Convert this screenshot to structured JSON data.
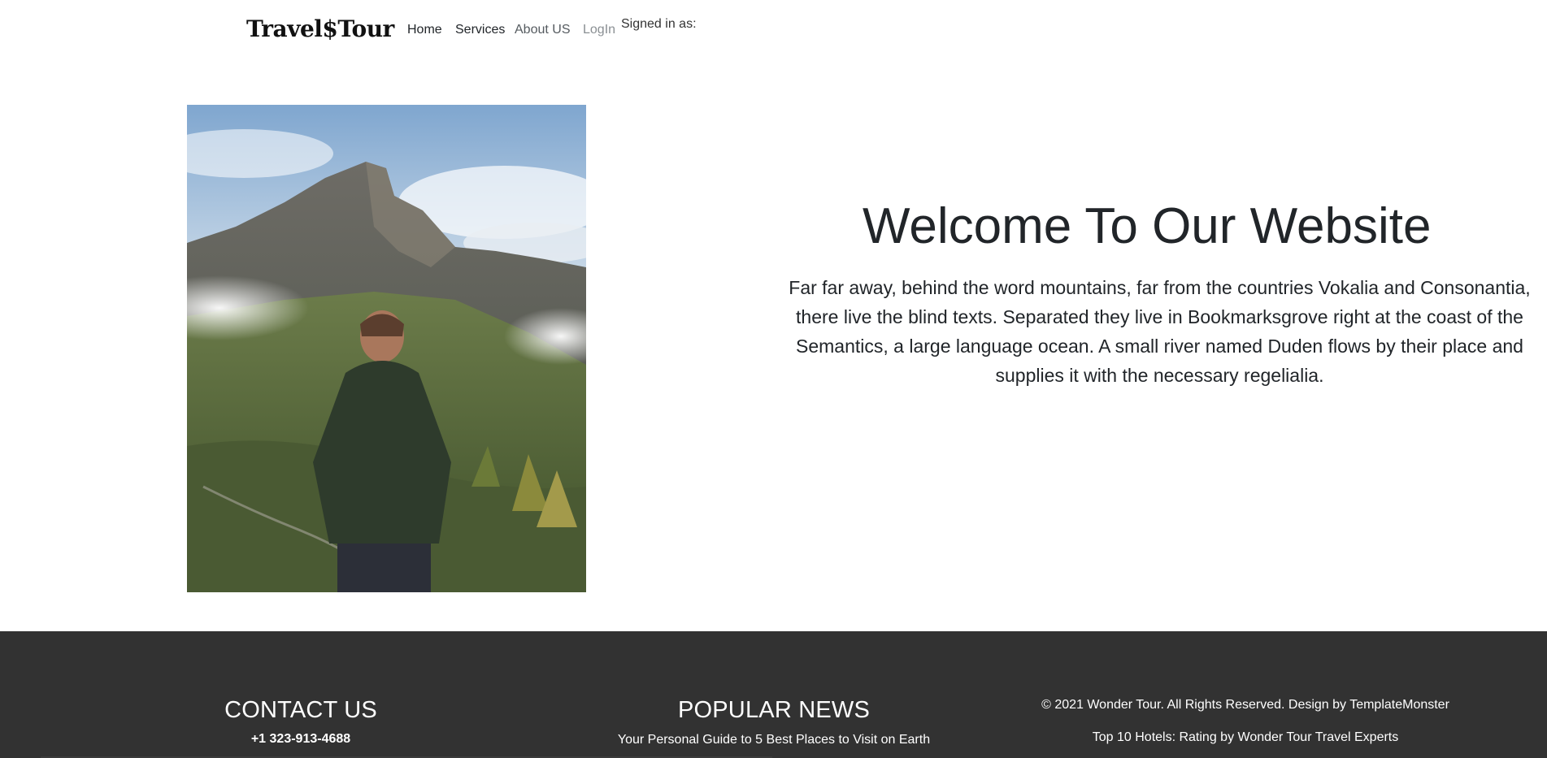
{
  "header": {
    "brand": "Travel$Tour",
    "nav": {
      "home": "Home",
      "services": "Services",
      "about": "About US",
      "login": "LogIn"
    },
    "signed_in": "Signed in as:"
  },
  "hero": {
    "title": "Welcome To Our Website",
    "text": "Far far away, behind the word mountains, far from the countries Vokalia and Consonantia, there live the blind texts. Separated they live in Bookmarksgrove right at the coast of the Semantics, a large language ocean. A small river named Duden flows by their place and supplies it with the necessary regelialia."
  },
  "footer": {
    "contact": {
      "heading": "CONTACT US",
      "phone": "+1 323-913-4688"
    },
    "news": {
      "heading": "POPULAR NEWS",
      "item": "Your Personal Guide to 5 Best Places to Visit on Earth"
    },
    "copyright": {
      "text": "© 2021 Wonder Tour. All Rights Reserved. Design by TemplateMonster",
      "item": "Top 10 Hotels: Rating by Wonder Tour Travel Experts"
    }
  },
  "colors": {
    "footer_bg": "#323232",
    "text_dark": "#212529"
  }
}
